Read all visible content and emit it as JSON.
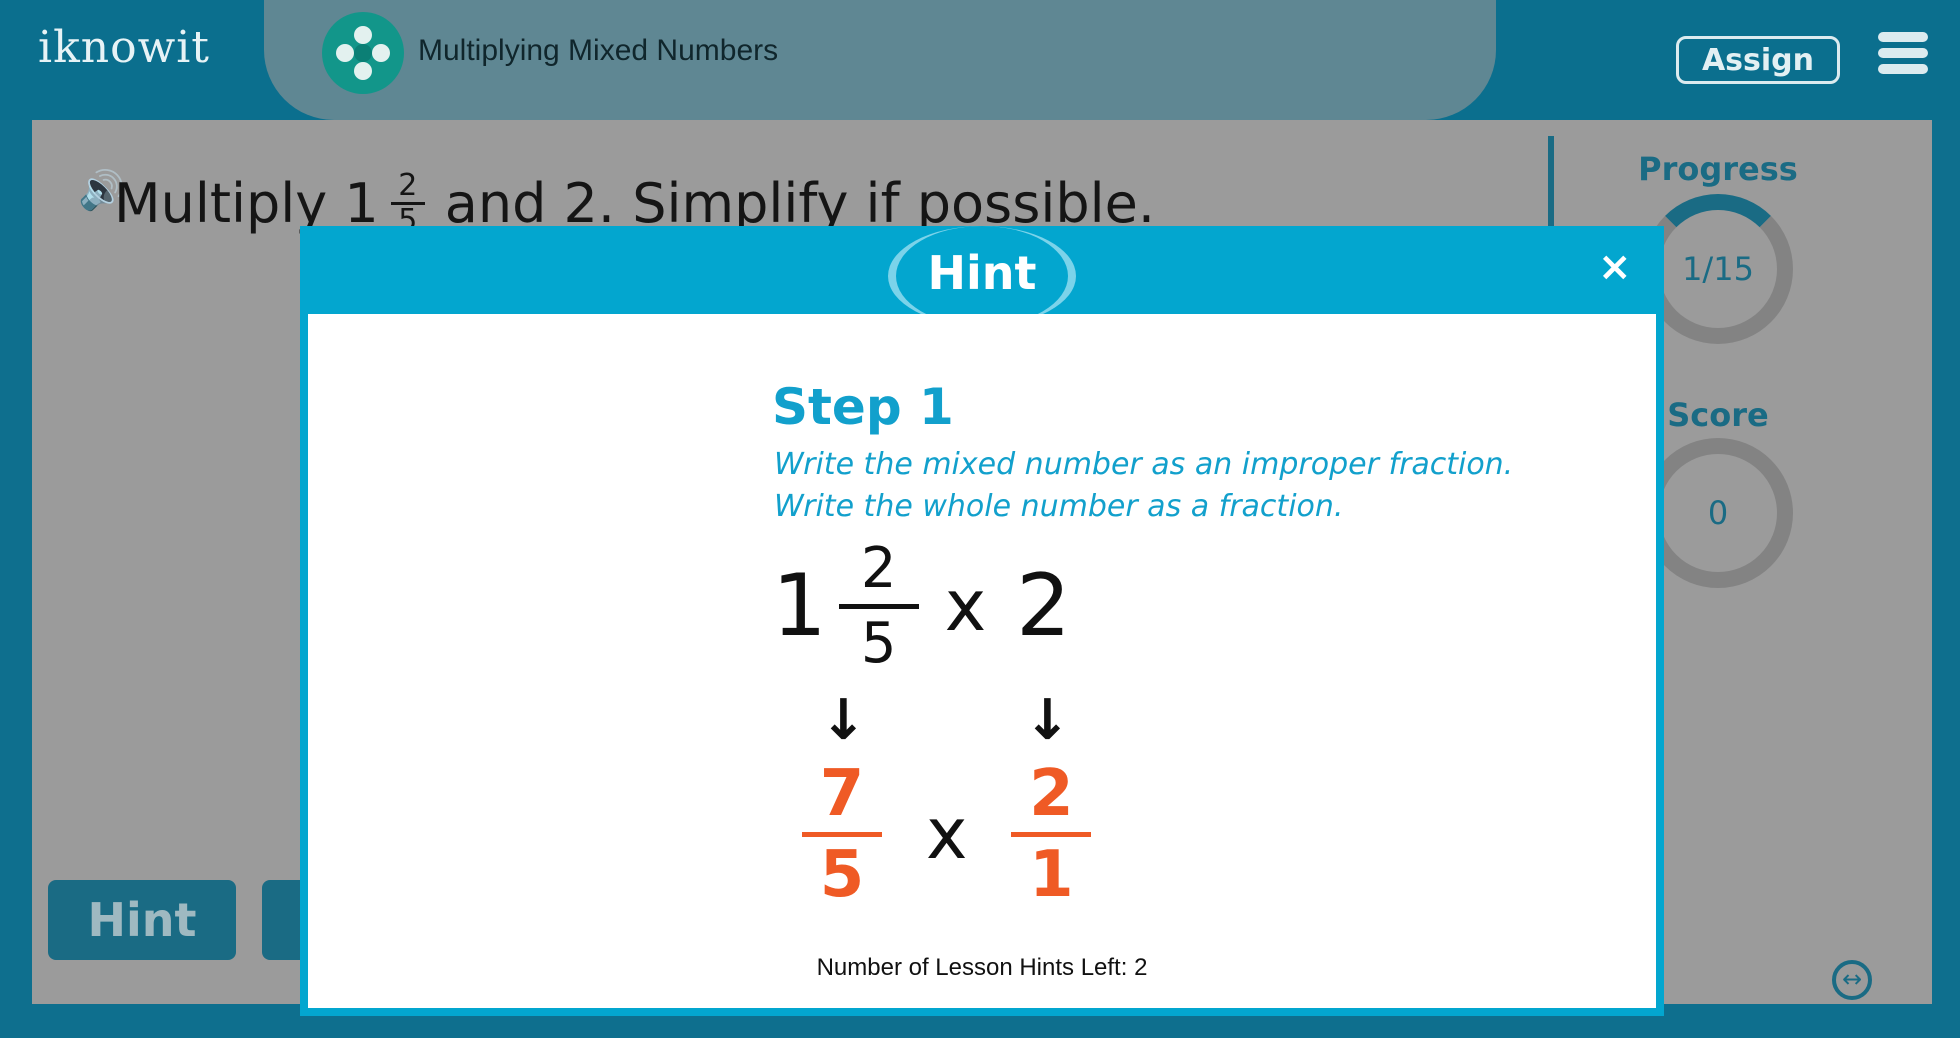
{
  "header": {
    "logo": "iknowit",
    "lesson_title": "Multiplying Mixed Numbers",
    "assign_label": "Assign"
  },
  "question": {
    "prefix": "Multiply 1",
    "numerator": "2",
    "denominator": "5",
    "suffix": "and 2. Simplify if possible."
  },
  "sidebar": {
    "progress_label": "Progress",
    "progress_value": "1/15",
    "progress_fraction": 0.067,
    "score_label": "Score",
    "score_value": "0"
  },
  "bottom": {
    "hint_label": "Hint"
  },
  "modal": {
    "title": "Hint",
    "close_symbol": "×",
    "step_title": "Step 1",
    "step_line1": "Write the mixed number as an improper fraction.",
    "step_line2": "Write the whole number as a fraction.",
    "eq1": {
      "whole": "1",
      "numerator": "2",
      "denominator": "5",
      "operator": "x",
      "second": "2"
    },
    "arrow_symbol": "↓",
    "eq2": {
      "a_numerator": "7",
      "a_denominator": "5",
      "operator": "x",
      "b_numerator": "2",
      "b_denominator": "1"
    },
    "hints_left": "Number of Lesson Hints Left: 2"
  },
  "colors": {
    "brand_teal": "#0b6f8e",
    "hint_blue": "#03a6cf",
    "result_orange": "#ef5a25"
  },
  "icons": [
    "speaker-icon",
    "lesson-icon",
    "menu-icon",
    "close-icon",
    "expand-icon",
    "pencil-icon"
  ]
}
